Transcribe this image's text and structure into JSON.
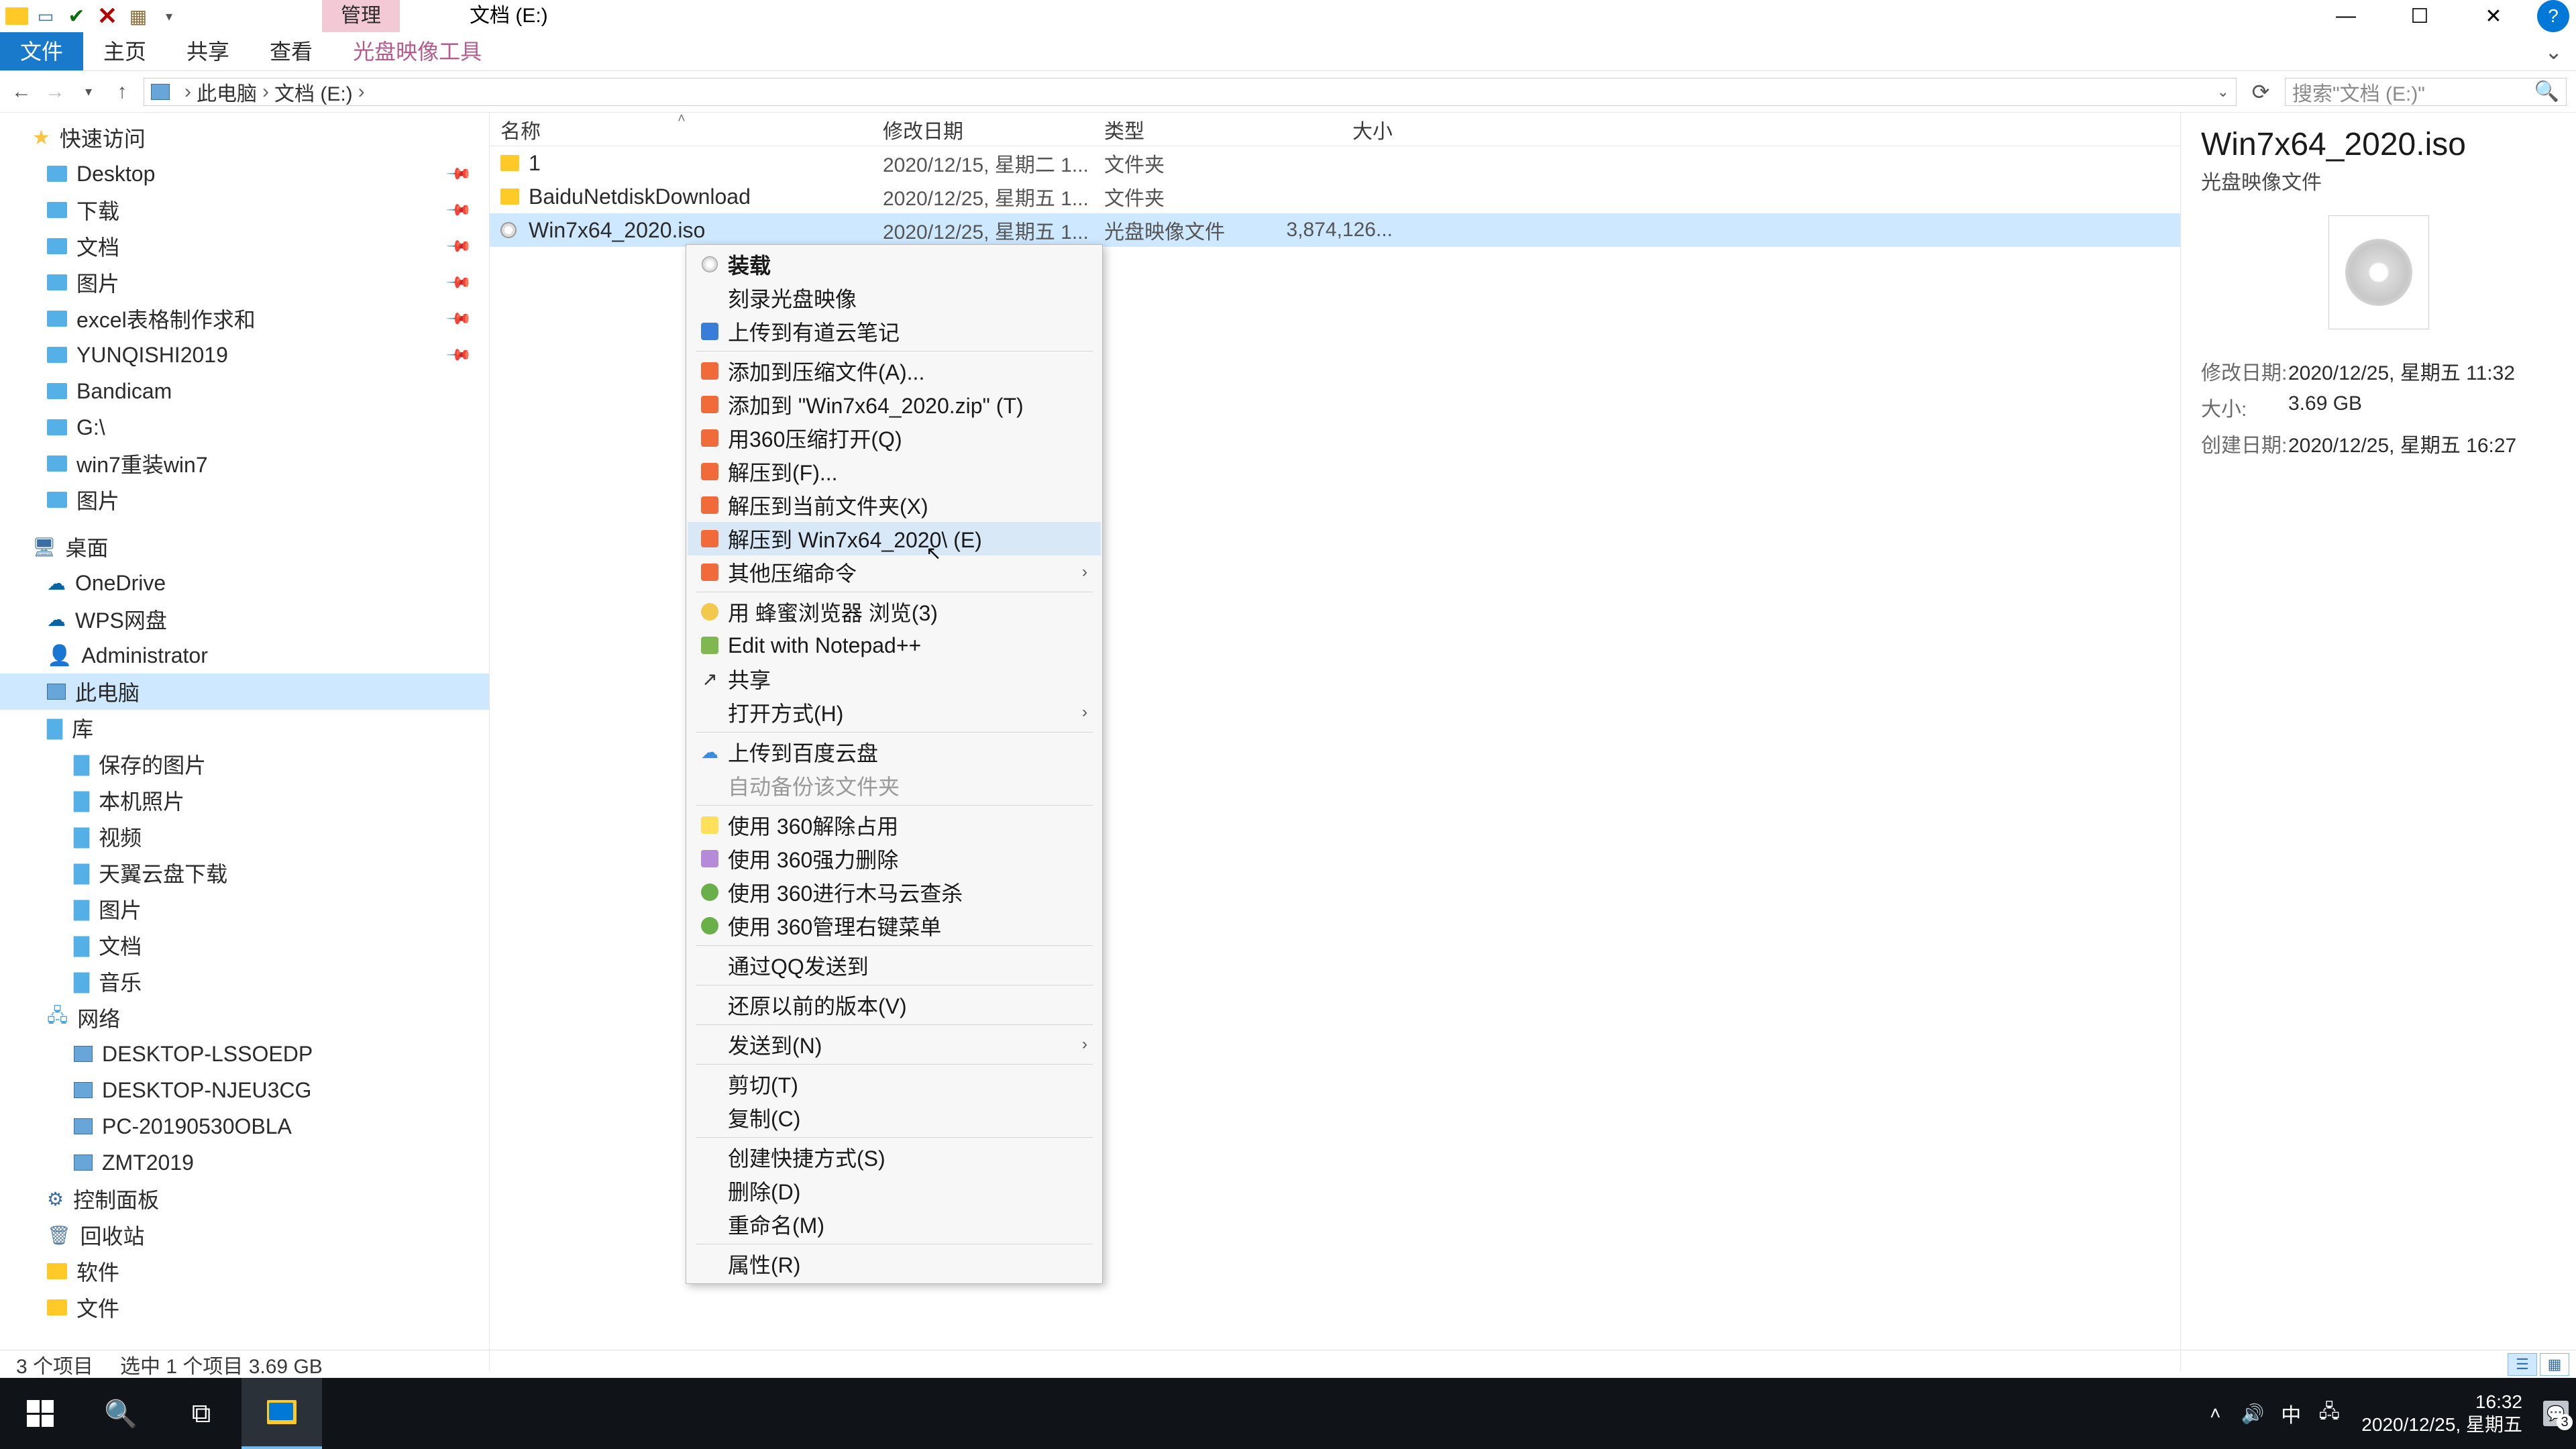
{
  "window": {
    "title": "文档 (E:)",
    "contextual_tab": "管理",
    "help": "?"
  },
  "ribbon": {
    "tabs": [
      "文件",
      "主页",
      "共享",
      "查看",
      "光盘映像工具"
    ],
    "active_index": 0
  },
  "address": {
    "segments": [
      "此电脑",
      "文档 (E:)"
    ],
    "search_placeholder": "搜索\"文档 (E:)\""
  },
  "nav_tree": {
    "quick_access": {
      "label": "快速访问"
    },
    "qa_items": [
      {
        "label": "Desktop",
        "pin": true
      },
      {
        "label": "下载",
        "pin": true
      },
      {
        "label": "文档",
        "pin": true
      },
      {
        "label": "图片",
        "pin": true
      },
      {
        "label": "excel表格制作求和",
        "pin": true
      },
      {
        "label": "YUNQISHI2019",
        "pin": true
      },
      {
        "label": "Bandicam"
      },
      {
        "label": "G:\\"
      },
      {
        "label": "win7重装win7"
      },
      {
        "label": "图片"
      }
    ],
    "desktop_root": {
      "label": "桌面"
    },
    "onedrive": {
      "label": "OneDrive"
    },
    "wps": {
      "label": "WPS网盘"
    },
    "admin": {
      "label": "Administrator"
    },
    "this_pc": {
      "label": "此电脑"
    },
    "libraries": {
      "label": "库"
    },
    "lib_items": [
      {
        "label": "保存的图片"
      },
      {
        "label": "本机照片"
      },
      {
        "label": "视频"
      },
      {
        "label": "天翼云盘下载"
      },
      {
        "label": "图片"
      },
      {
        "label": "文档"
      },
      {
        "label": "音乐"
      }
    ],
    "network": {
      "label": "网络"
    },
    "net_items": [
      {
        "label": "DESKTOP-LSSOEDP"
      },
      {
        "label": "DESKTOP-NJEU3CG"
      },
      {
        "label": "PC-20190530OBLA"
      },
      {
        "label": "ZMT2019"
      }
    ],
    "control_panel": {
      "label": "控制面板"
    },
    "recycle": {
      "label": "回收站"
    },
    "software": {
      "label": "软件"
    },
    "files": {
      "label": "文件"
    }
  },
  "columns": {
    "name": "名称",
    "modified": "修改日期",
    "type": "类型",
    "size": "大小"
  },
  "files": [
    {
      "icon": "folder",
      "name": "1",
      "date": "2020/12/15, 星期二 1...",
      "type": "文件夹",
      "size": ""
    },
    {
      "icon": "folder",
      "name": "BaiduNetdiskDownload",
      "date": "2020/12/25, 星期五 1...",
      "type": "文件夹",
      "size": ""
    },
    {
      "icon": "disc",
      "name": "Win7x64_2020.iso",
      "date": "2020/12/25, 星期五 1...",
      "type": "光盘映像文件",
      "size": "3,874,126...",
      "selected": true
    }
  ],
  "details": {
    "title": "Win7x64_2020.iso",
    "type": "光盘映像文件",
    "rows": [
      {
        "label": "修改日期:",
        "value": "2020/12/25, 星期五 11:32"
      },
      {
        "label": "大小:",
        "value": "3.69 GB"
      },
      {
        "label": "创建日期:",
        "value": "2020/12/25, 星期五 16:27"
      }
    ]
  },
  "context_menu": {
    "groups": [
      [
        {
          "label": "装载",
          "bold": true,
          "icon": "cd"
        },
        {
          "label": "刻录光盘映像"
        },
        {
          "label": "上传到有道云笔记",
          "icon": "blue-box"
        }
      ],
      [
        {
          "label": "添加到压缩文件(A)...",
          "icon": "book"
        },
        {
          "label": "添加到 \"Win7x64_2020.zip\" (T)",
          "icon": "book"
        },
        {
          "label": "用360压缩打开(Q)",
          "icon": "book"
        },
        {
          "label": "解压到(F)...",
          "icon": "book"
        },
        {
          "label": "解压到当前文件夹(X)",
          "icon": "book"
        },
        {
          "label": "解压到 Win7x64_2020\\ (E)",
          "icon": "book",
          "hover": true
        },
        {
          "label": "其他压缩命令",
          "icon": "book",
          "submenu": true
        }
      ],
      [
        {
          "label": "用 蜂蜜浏览器 浏览(3)",
          "icon": "bee"
        },
        {
          "label": "Edit with Notepad++",
          "icon": "note"
        },
        {
          "label": "共享",
          "icon": "share"
        },
        {
          "label": "打开方式(H)",
          "submenu": true
        }
      ],
      [
        {
          "label": "上传到百度云盘",
          "icon": "cloud"
        },
        {
          "label": "自动备份该文件夹",
          "disabled": true
        }
      ],
      [
        {
          "label": "使用 360解除占用",
          "icon": "shield360"
        },
        {
          "label": "使用 360强力删除",
          "icon": "purple"
        },
        {
          "label": "使用 360进行木马云查杀",
          "icon": "shield-g"
        },
        {
          "label": "使用 360管理右键菜单",
          "icon": "shield-g"
        }
      ],
      [
        {
          "label": "通过QQ发送到"
        }
      ],
      [
        {
          "label": "还原以前的版本(V)"
        }
      ],
      [
        {
          "label": "发送到(N)",
          "submenu": true
        }
      ],
      [
        {
          "label": "剪切(T)"
        },
        {
          "label": "复制(C)"
        }
      ],
      [
        {
          "label": "创建快捷方式(S)"
        },
        {
          "label": "删除(D)"
        },
        {
          "label": "重命名(M)"
        }
      ],
      [
        {
          "label": "属性(R)"
        }
      ]
    ]
  },
  "status": {
    "count": "3 个项目",
    "selected": "选中 1 个项目  3.69 GB"
  },
  "taskbar": {
    "time": "16:32",
    "date": "2020/12/25, 星期五",
    "lang": "中",
    "notif_count": "3"
  }
}
